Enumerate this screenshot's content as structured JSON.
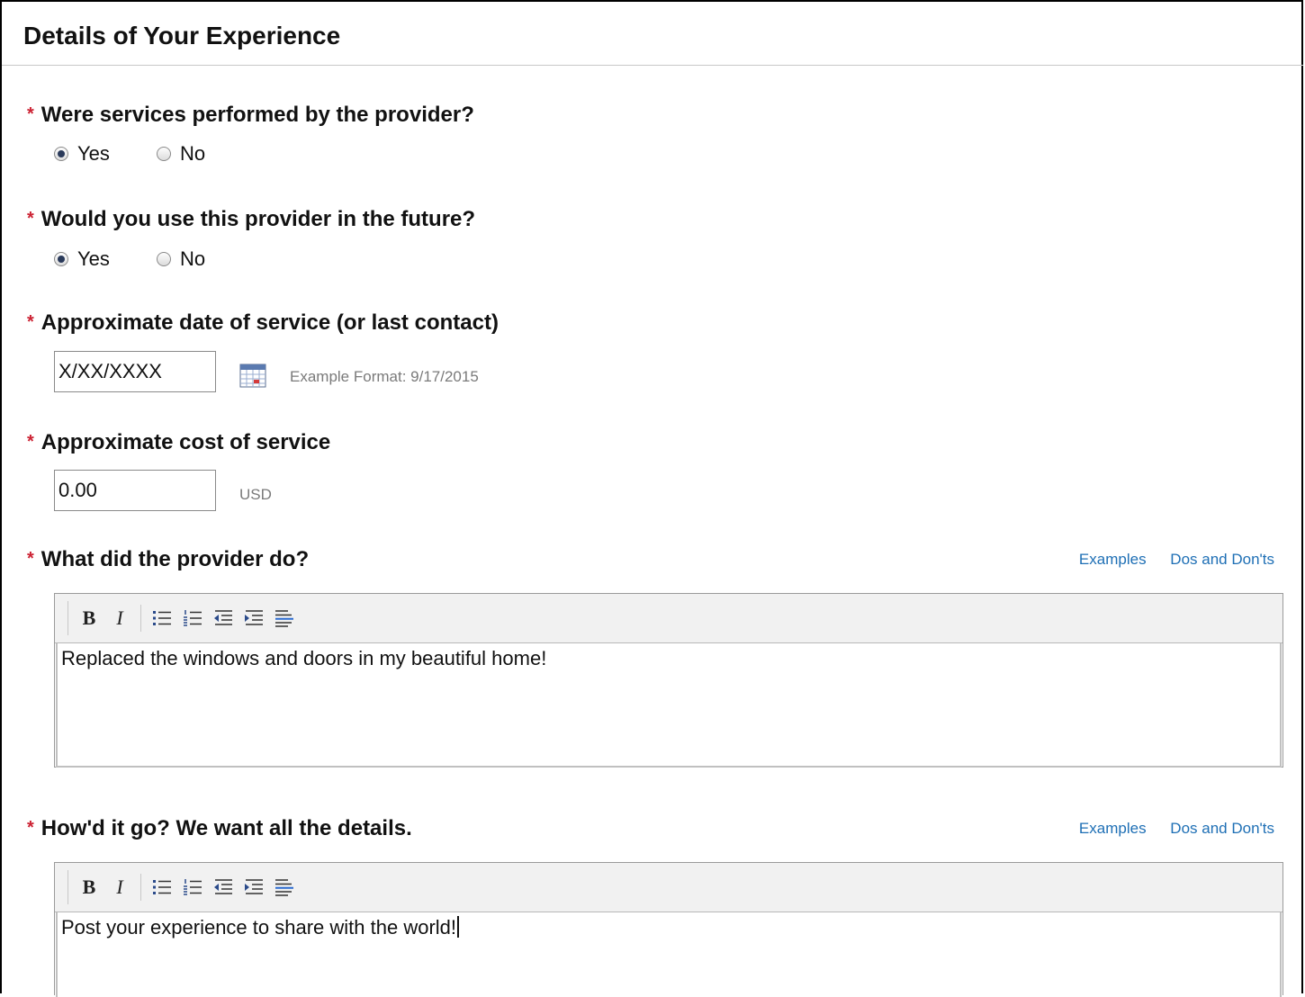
{
  "section": {
    "title": "Details of Your Experience"
  },
  "required_marker": "*",
  "colors": {
    "required": "#cc2233",
    "link": "#1e6fb5",
    "hint": "#7a7a7a"
  },
  "q_services": {
    "label": "Were services performed by the provider?",
    "options": [
      {
        "label": "Yes",
        "checked": true
      },
      {
        "label": "No",
        "checked": false
      }
    ]
  },
  "q_future": {
    "label": "Would you use this provider in the future?",
    "options": [
      {
        "label": "Yes",
        "checked": true
      },
      {
        "label": "No",
        "checked": false
      }
    ]
  },
  "q_date": {
    "label": "Approximate date of service (or last contact)",
    "value": "X/XX/XXXX",
    "hint": "Example Format: 9/17/2015",
    "icon": "calendar-icon"
  },
  "q_cost": {
    "label": "Approximate cost of service",
    "value": "0.00",
    "currency": "USD"
  },
  "q_what": {
    "label": "What did the provider do?",
    "links": {
      "examples": "Examples",
      "dos": "Dos and Don'ts"
    },
    "text": "Replaced the windows and doors in my beautiful home!"
  },
  "q_how": {
    "label": "How'd it go? We want all the details.",
    "links": {
      "examples": "Examples",
      "dos": "Dos and Don'ts"
    },
    "text": "Post your experience to share with the world!"
  },
  "toolbar": {
    "bold": "B",
    "italic": "I",
    "icons": [
      "bullet-list-icon",
      "numbered-list-icon",
      "outdent-icon",
      "indent-icon",
      "align-icon"
    ]
  }
}
